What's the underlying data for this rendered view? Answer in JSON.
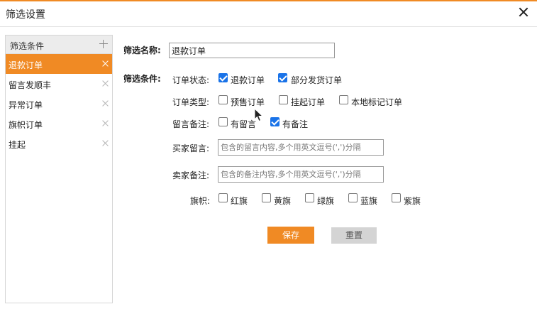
{
  "dialog": {
    "title": "筛选设置"
  },
  "sidebar": {
    "header": "筛选条件",
    "items": [
      {
        "label": "退款订单",
        "active": true
      },
      {
        "label": "留言发顺丰",
        "active": false
      },
      {
        "label": "异常订单",
        "active": false
      },
      {
        "label": "旗帜订单",
        "active": false
      },
      {
        "label": "挂起",
        "active": false
      }
    ]
  },
  "form": {
    "name_label": "筛选名称:",
    "name_value": "退款订单",
    "conditions_label": "筛选条件:",
    "order_status": {
      "label": "订单状态:",
      "options": [
        {
          "label": "退款订单",
          "checked": true
        },
        {
          "label": "部分发货订单",
          "checked": true
        }
      ]
    },
    "order_type": {
      "label": "订单类型:",
      "options": [
        {
          "label": "预售订单",
          "checked": false
        },
        {
          "label": "挂起订单",
          "checked": false
        },
        {
          "label": "本地标记订单",
          "checked": false
        }
      ]
    },
    "memo": {
      "label": "留言备注:",
      "options": [
        {
          "label": "有留言",
          "checked": false
        },
        {
          "label": "有备注",
          "checked": true
        }
      ]
    },
    "buyer_message": {
      "label": "买家留言:",
      "value": "",
      "placeholder": "包含的留言内容,多个用英文逗号(',')分隔"
    },
    "seller_memo": {
      "label": "卖家备注:",
      "value": "",
      "placeholder": "包含的备注内容,多个用英文逗号(',')分隔"
    },
    "flags": {
      "label": "旗帜:",
      "options": [
        {
          "label": "红旗",
          "checked": false
        },
        {
          "label": "黄旗",
          "checked": false
        },
        {
          "label": "绿旗",
          "checked": false
        },
        {
          "label": "蓝旗",
          "checked": false
        },
        {
          "label": "紫旗",
          "checked": false
        }
      ]
    }
  },
  "buttons": {
    "save": "保存",
    "reset": "重置"
  },
  "colors": {
    "accent": "#f08a24",
    "checkbox": "#1a73e8",
    "reset_bg": "#d4d4d4"
  }
}
